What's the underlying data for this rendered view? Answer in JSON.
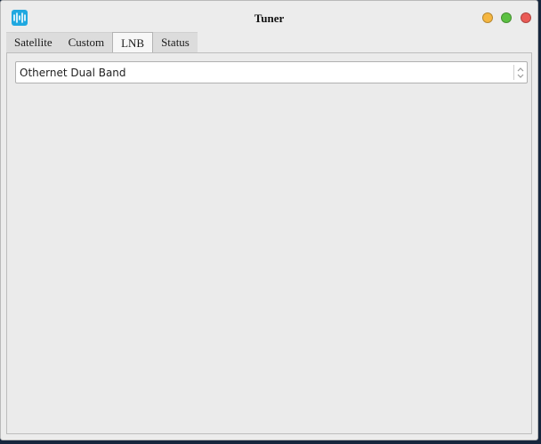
{
  "window": {
    "title": "Tuner",
    "icon": "app-logo-icon",
    "controls": {
      "minimize_color": "#f5b640",
      "maximize_color": "#5cc142",
      "close_color": "#ea5b56"
    }
  },
  "tabs": [
    {
      "label": "Satellite",
      "active": false
    },
    {
      "label": "Custom",
      "active": false
    },
    {
      "label": "LNB",
      "active": true
    },
    {
      "label": "Status",
      "active": false
    }
  ],
  "lnb": {
    "selected_value": "Othernet Dual Band"
  },
  "colors": {
    "accent": "#1fa8e0",
    "window_bg": "#ececec",
    "desktop_bg": "#16263d"
  }
}
